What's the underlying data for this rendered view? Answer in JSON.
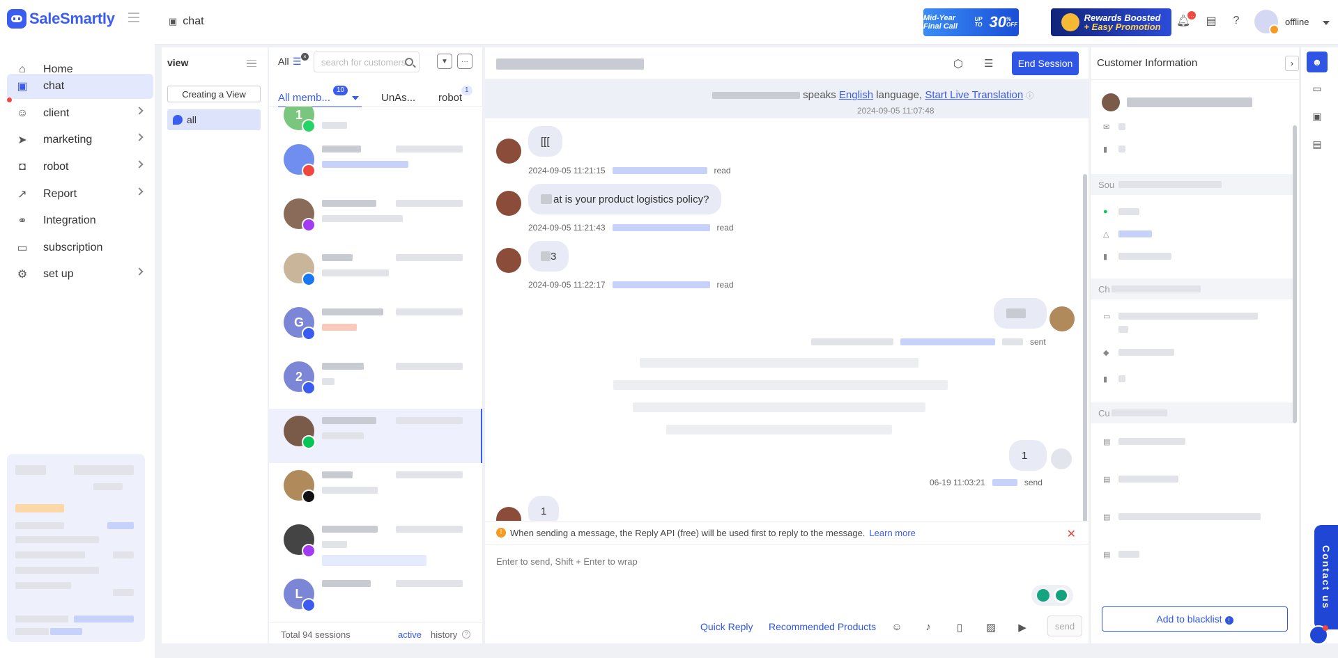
{
  "brand": {
    "name": "SaleSmartly"
  },
  "nav": {
    "items": [
      {
        "label": "Home",
        "icon": "home-icon",
        "chevron": false
      },
      {
        "label": "chat",
        "icon": "chat-icon",
        "chevron": false,
        "active": true
      },
      {
        "label": "client",
        "icon": "users-icon",
        "chevron": true
      },
      {
        "label": "marketing",
        "icon": "send-icon",
        "chevron": true
      },
      {
        "label": "robot",
        "icon": "robot-icon",
        "chevron": true
      },
      {
        "label": "Report",
        "icon": "chart-icon",
        "chevron": true
      },
      {
        "label": "Integration",
        "icon": "integration-icon",
        "chevron": false
      },
      {
        "label": "subscription",
        "icon": "wallet-icon",
        "chevron": false
      },
      {
        "label": "set up",
        "icon": "gear-icon",
        "chevron": true
      }
    ]
  },
  "topbar": {
    "tab": "chat",
    "banner1": {
      "text": "Mid-Year Final Call",
      "prefix": "UP TO",
      "big": "30",
      "suffix": "% OFF"
    },
    "banner2": {
      "line1": "Rewards Boosted",
      "line2": "+ Easy Promotion"
    },
    "user_status": "offline"
  },
  "views": {
    "title": "view",
    "create_label": "Creating a View",
    "items": [
      {
        "label": "all"
      }
    ]
  },
  "sessions": {
    "filter_label": "All",
    "search_placeholder": "search for customers",
    "tabs": {
      "all": "All memb...",
      "all_badge": "10",
      "unassigned": "UnAs...",
      "robot": "robot",
      "robot_badge": "1"
    },
    "total": "Total 94 sessions",
    "active_tab": "active",
    "history_tab": "history",
    "items": [
      {
        "avatar_text": "1",
        "avatar_color": "#7bc67e",
        "channel_color": "#25d366",
        "channel": "whatsapp-icon"
      },
      {
        "avatar_text": "",
        "avatar_color": "#6f8ef0",
        "channel_color": "#f0483e",
        "channel": "email-icon"
      },
      {
        "avatar_text": "",
        "avatar_color": "#8a6b5a",
        "channel_color": "#a33bf5",
        "channel": "messenger-icon"
      },
      {
        "avatar_text": "",
        "avatar_color": "#c9b59a",
        "channel_color": "#1877f2",
        "channel": "facebook-icon"
      },
      {
        "avatar_text": "G",
        "avatar_color": "#7b86d6",
        "channel_color": "#3b5cf0",
        "channel": "chat-channel-icon"
      },
      {
        "avatar_text": "2",
        "avatar_color": "#7b86d6",
        "channel_color": "#3b5cf0",
        "channel": "chat-channel-icon"
      },
      {
        "avatar_text": "",
        "avatar_color": "#7a5a48",
        "channel_color": "#06c755",
        "channel": "line-icon",
        "active": true
      },
      {
        "avatar_text": "",
        "avatar_color": "#b08a5a",
        "channel_color": "#111111",
        "channel": "tiktok-icon"
      },
      {
        "avatar_text": "",
        "avatar_color": "#444444",
        "channel_color": "#a33bf5",
        "channel": "messenger-icon"
      },
      {
        "avatar_text": "L",
        "avatar_color": "#7b86d6",
        "channel_color": "#3b5cf0",
        "channel": "chat-channel-icon"
      }
    ]
  },
  "chat": {
    "end_session_label": "End Session",
    "translate": {
      "speaks": "speaks",
      "language": "English",
      "language_suffix": "language,",
      "link": "Start Live Translation",
      "timestamp": "2024-09-05 11:07:48"
    },
    "messages": [
      {
        "text": "[[[",
        "time": "2024-09-05 11:21:15",
        "status": "read"
      },
      {
        "text": "at is your product logistics policy?",
        "time": "2024-09-05 11:21:43",
        "status": "read"
      },
      {
        "text": "3",
        "time": "2024-09-05 11:22:17",
        "status": "read"
      },
      {
        "status": "sent"
      },
      {
        "text": "1",
        "time": "06-19 11:03:21",
        "status": "send"
      },
      {
        "text": "1"
      }
    ],
    "notice": "When sending a message, the Reply API (free) will be used first to reply to the message.",
    "notice_link": "Learn more",
    "compose_placeholder": "Enter to send, Shift + Enter to wrap",
    "quick_reply": "Quick Reply",
    "recommended": "Recommended Products",
    "send_label": "send"
  },
  "customer": {
    "title": "Customer Information",
    "sections": [
      "Sou",
      "Ch",
      "Cu"
    ],
    "blacklist_label": "Add to blacklist"
  },
  "contact_us": "Contact us",
  "colors": {
    "accent": "#2f55e4",
    "brand": "#3b5cf0",
    "danger": "#e2473a"
  }
}
